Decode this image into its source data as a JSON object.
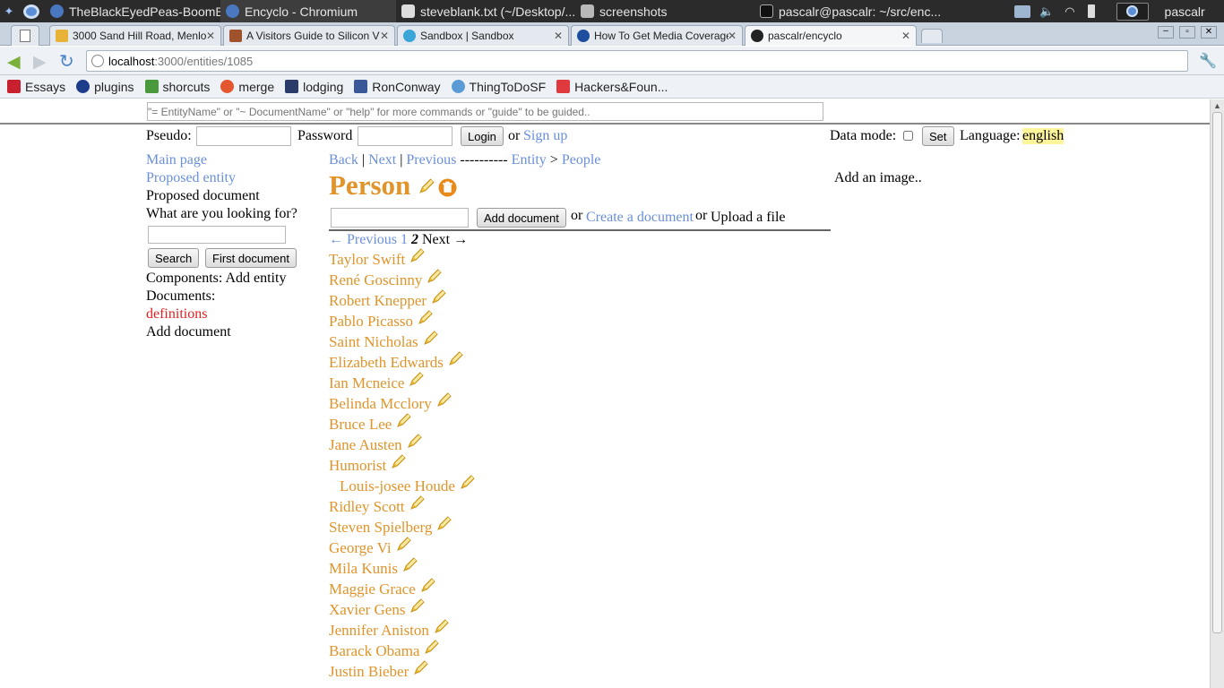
{
  "os_panel": {
    "apps": [
      "TheBlackEyedPeas-BoomB...",
      "Encyclo - Chromium",
      "steveblank.txt (~/Desktop/...",
      "screenshots",
      "pascalr@pascalr: ~/src/enc..."
    ],
    "user": "pascalr"
  },
  "tabs": [
    {
      "title": "3000 Sand Hill Road, Menlo",
      "color": "#e8b339"
    },
    {
      "title": "A Visitors Guide to Silicon V",
      "color": "#a0522d"
    },
    {
      "title": "Sandbox | Sandbox",
      "color": "#3aa6d8"
    },
    {
      "title": "How To Get Media Coverage",
      "color": "#1d4e9e"
    },
    {
      "title": "pascalr/encyclo",
      "color": "#222222"
    }
  ],
  "address": {
    "host": "localhost",
    "path": ":3000/entities/1085"
  },
  "bookmarks": [
    "Essays",
    "plugins",
    "shorcuts",
    "merge",
    "lodging",
    "RonConway",
    "ThingToDoSF",
    "Hackers&Foun..."
  ],
  "command_bar": {
    "placeholder": "\"= EntityName\" or \"~ DocumentName\" or \"help\" for more commands or \"guide\" to be guided.."
  },
  "login": {
    "pseudo_label": "Pseudo:",
    "password_label": "Password",
    "login_button": "Login",
    "or_text": "or",
    "signup": "Sign up"
  },
  "data_mode": {
    "label": "Data mode:",
    "set_button": "Set",
    "language_label": "Language:",
    "language": "english"
  },
  "sidebar": {
    "main_page": "Main page",
    "proposed_entity": "Proposed entity",
    "proposed_document": "Proposed document",
    "looking_for": "What are you looking for?",
    "search_button": "Search",
    "first_document_button": "First document",
    "components": "Components: Add entity",
    "documents": "Documents:",
    "definitions": "definitions",
    "add_document": "Add document"
  },
  "nav": {
    "back": "Back",
    "next": "Next",
    "previous": "Previous",
    "dashes": "----------",
    "entity": "Entity",
    "sep": ">",
    "people": "People"
  },
  "title": "Person",
  "add_doc": {
    "button": "Add document",
    "or1": "or",
    "create": "Create a document",
    "or2": "or",
    "upload": "Upload a file"
  },
  "pagination": {
    "previous": "← Previous",
    "page1": "1",
    "current": "2",
    "next": "Next →"
  },
  "add_image": "Add an image..",
  "entities": [
    "Taylor Swift",
    "René Goscinny",
    "Robert Knepper",
    "Pablo Picasso",
    "Saint Nicholas",
    "Elizabeth Edwards",
    "Ian Mcneice",
    "Belinda Mcclory",
    "Bruce Lee",
    "Jane Austen",
    "Humorist",
    "Louis-josee Houde",
    "Ridley Scott",
    "Steven Spielberg",
    "George Vi",
    "Mila Kunis",
    "Maggie Grace",
    "Xavier Gens",
    "Jennifer Aniston",
    "Barack Obama",
    "Justin Bieber"
  ]
}
